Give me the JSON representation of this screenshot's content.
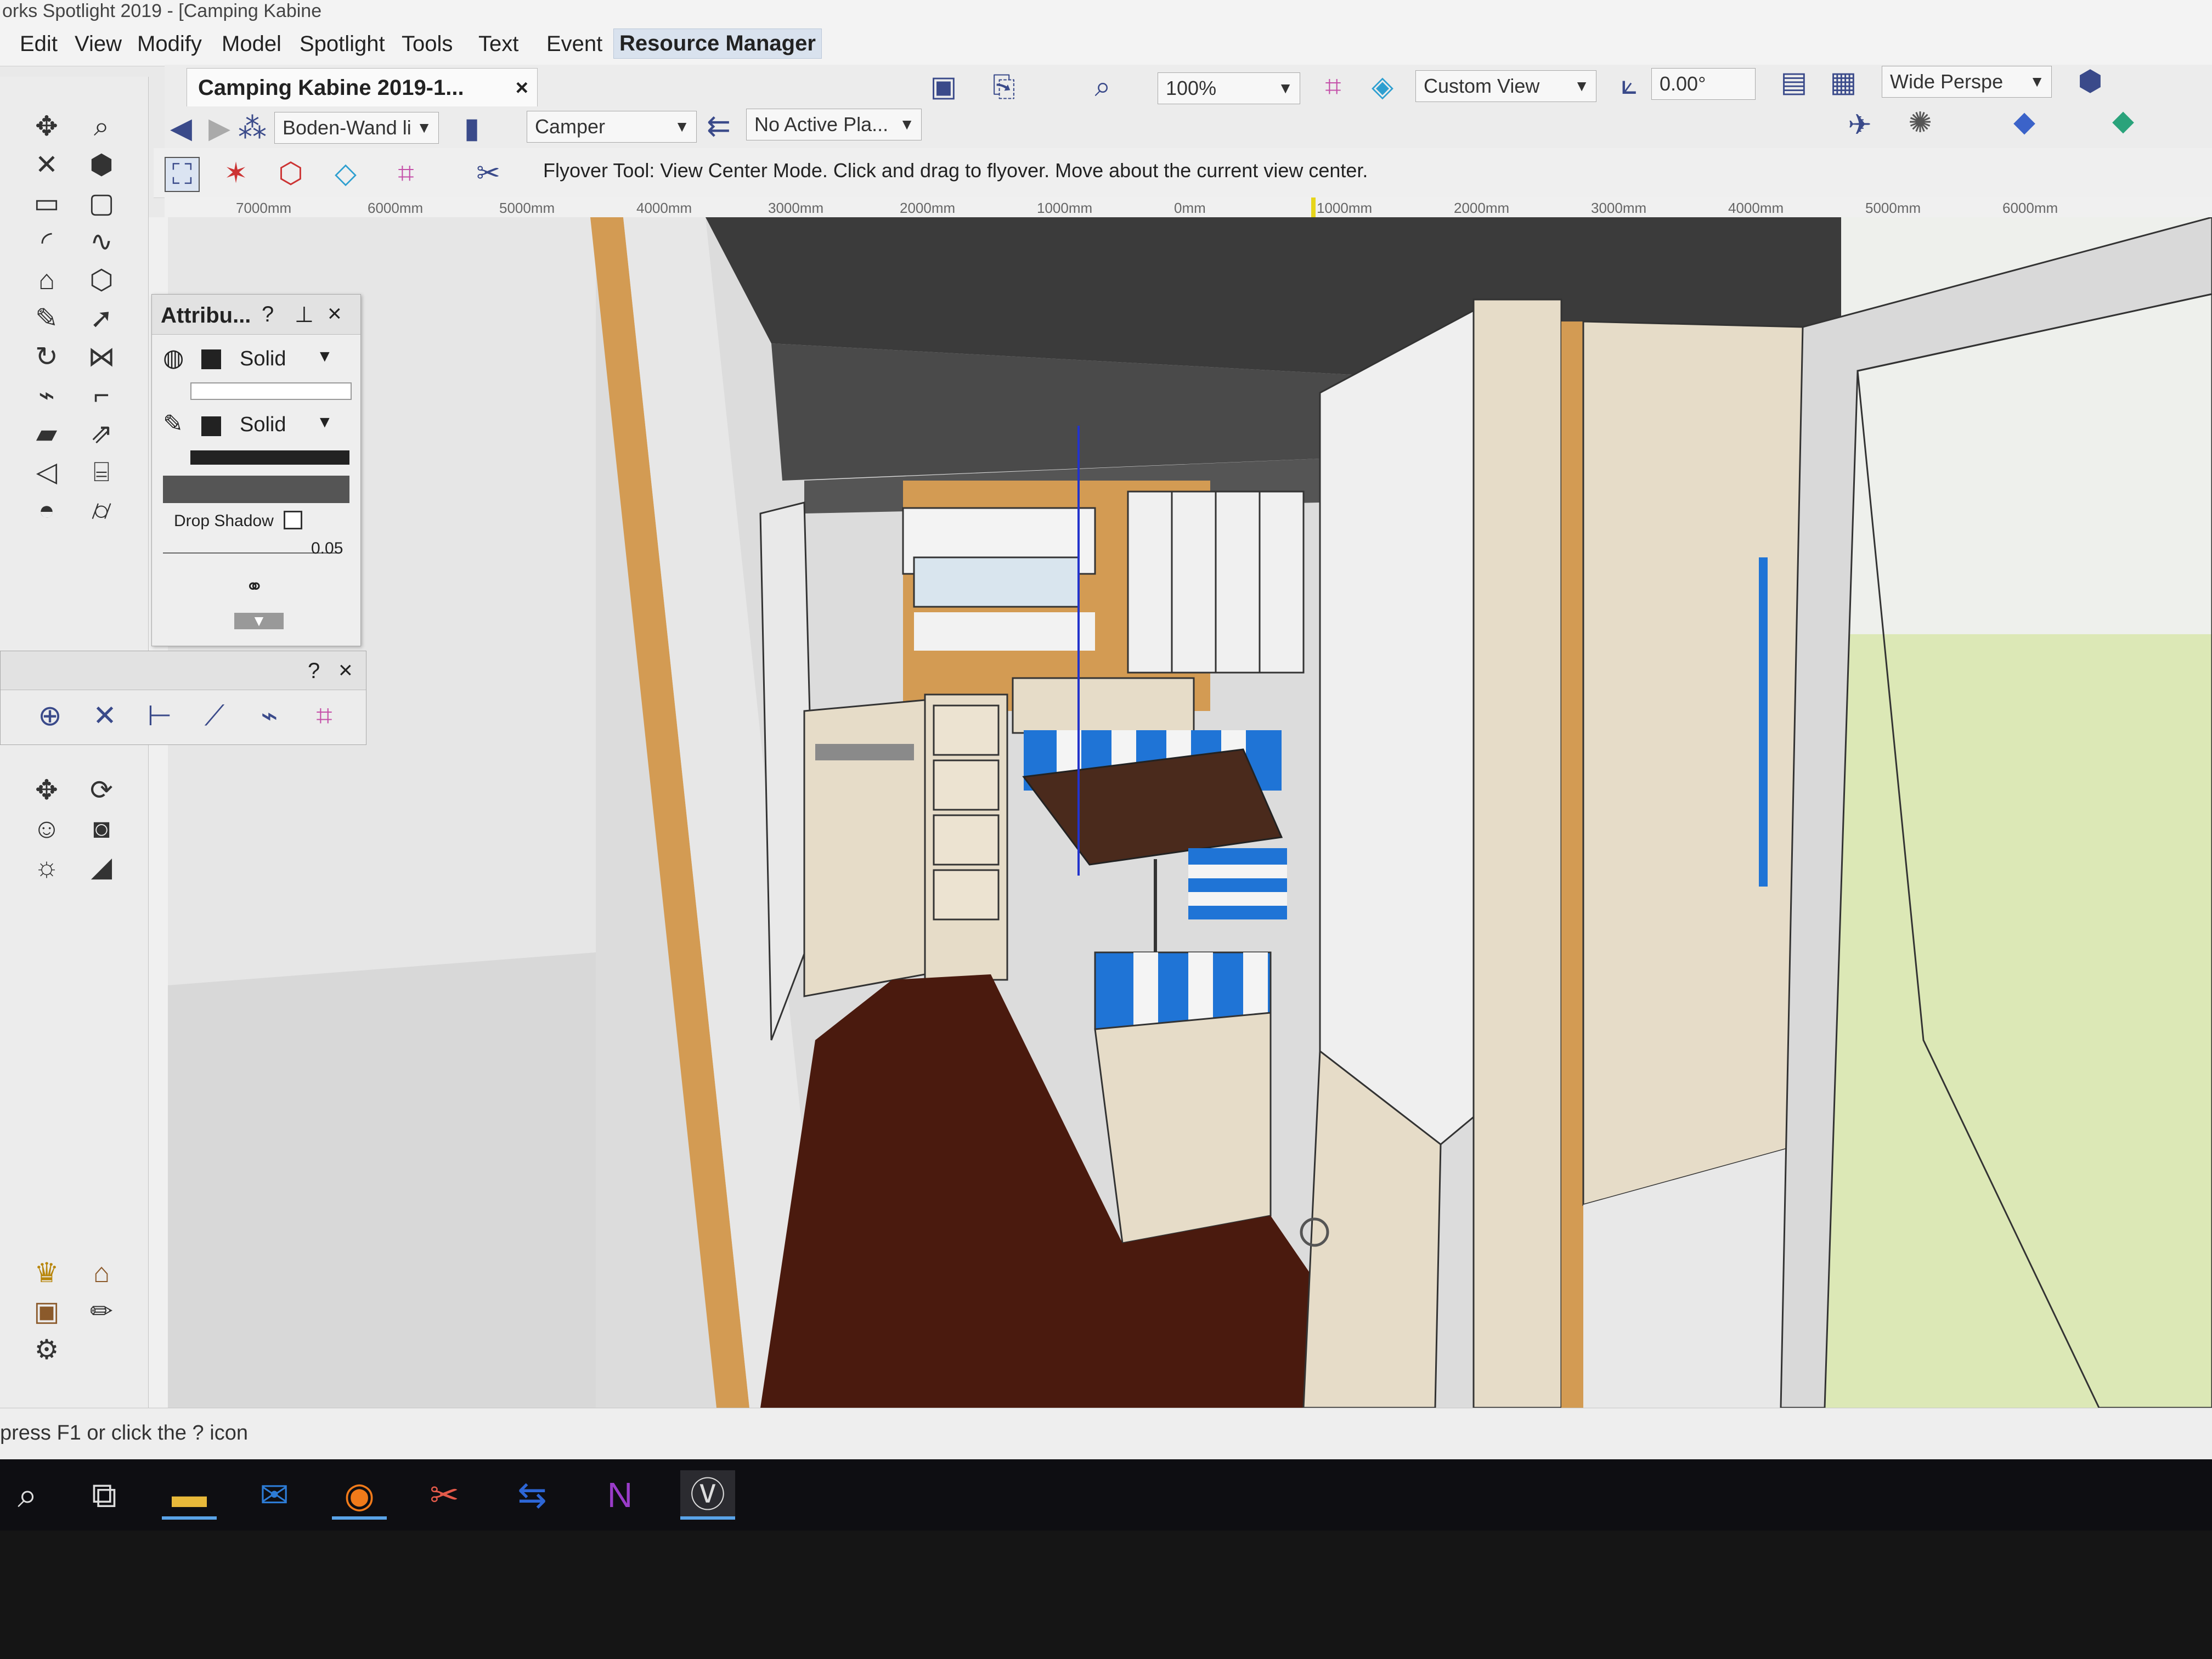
{
  "window": {
    "title": "orks Spotlight 2019 - [Camping Kabine"
  },
  "menu": {
    "items": [
      {
        "id": "edit",
        "label": "Edit"
      },
      {
        "id": "view",
        "label": "View"
      },
      {
        "id": "modify",
        "label": "Modify"
      },
      {
        "id": "model",
        "label": "Model"
      },
      {
        "id": "spotlight",
        "label": "Spotlight"
      },
      {
        "id": "tools",
        "label": "Tools"
      },
      {
        "id": "text",
        "label": "Text"
      },
      {
        "id": "event",
        "label": "Event"
      }
    ],
    "resource_manager": "Resource Manager"
  },
  "document_tab": {
    "label": "Camping Kabine 2019-1...",
    "close": "×"
  },
  "view_bar": {
    "class_value": "Boden-Wand li",
    "layer_value": "Camper",
    "plane_value": "No Active Pla...",
    "zoom_value": "100%",
    "view_value": "Custom View",
    "angle_value": "0.00°",
    "projection_value": "Wide Perspe"
  },
  "mode_bar": {
    "hint": "Flyover Tool: View Center Mode. Click and drag to flyover.  Move about the current view center."
  },
  "ruler_top": [
    "7000mm",
    "6000mm",
    "5000mm",
    "4000mm",
    "3000mm",
    "2000mm",
    "1000mm",
    "0mm",
    "1000mm",
    "2000mm",
    "3000mm",
    "4000mm",
    "5000mm",
    "6000mm"
  ],
  "attributes_palette": {
    "title": "Attribu...",
    "help": "?",
    "pin": "⊥",
    "close": "×",
    "fill_style": "Solid",
    "pen_style": "Solid",
    "drop_shadow_label": "Drop Shadow",
    "line_thickness": "0.05"
  },
  "snap_palette": {
    "help": "?",
    "close": "×"
  },
  "status": {
    "text": "press F1 or click the ? icon"
  },
  "taskbar": {
    "items": [
      {
        "id": "search",
        "icon": "search-icon"
      },
      {
        "id": "task-view",
        "icon": "task-view-icon"
      },
      {
        "id": "file-explorer",
        "icon": "folder-icon"
      },
      {
        "id": "outlook",
        "icon": "outlook-icon"
      },
      {
        "id": "firefox",
        "icon": "firefox-icon"
      },
      {
        "id": "snipping",
        "icon": "snipping-tool-icon"
      },
      {
        "id": "sync",
        "icon": "sync-icon"
      },
      {
        "id": "onenote",
        "icon": "onenote-icon"
      },
      {
        "id": "vectorworks",
        "icon": "vectorworks-icon"
      }
    ]
  },
  "colors": {
    "cushion_blue": "#1f74d6",
    "wood_floor": "#4a1a0e",
    "light_wood": "#e6dcc8",
    "orange_trim": "#d39b53",
    "ground_green": "#d9e7b3"
  }
}
